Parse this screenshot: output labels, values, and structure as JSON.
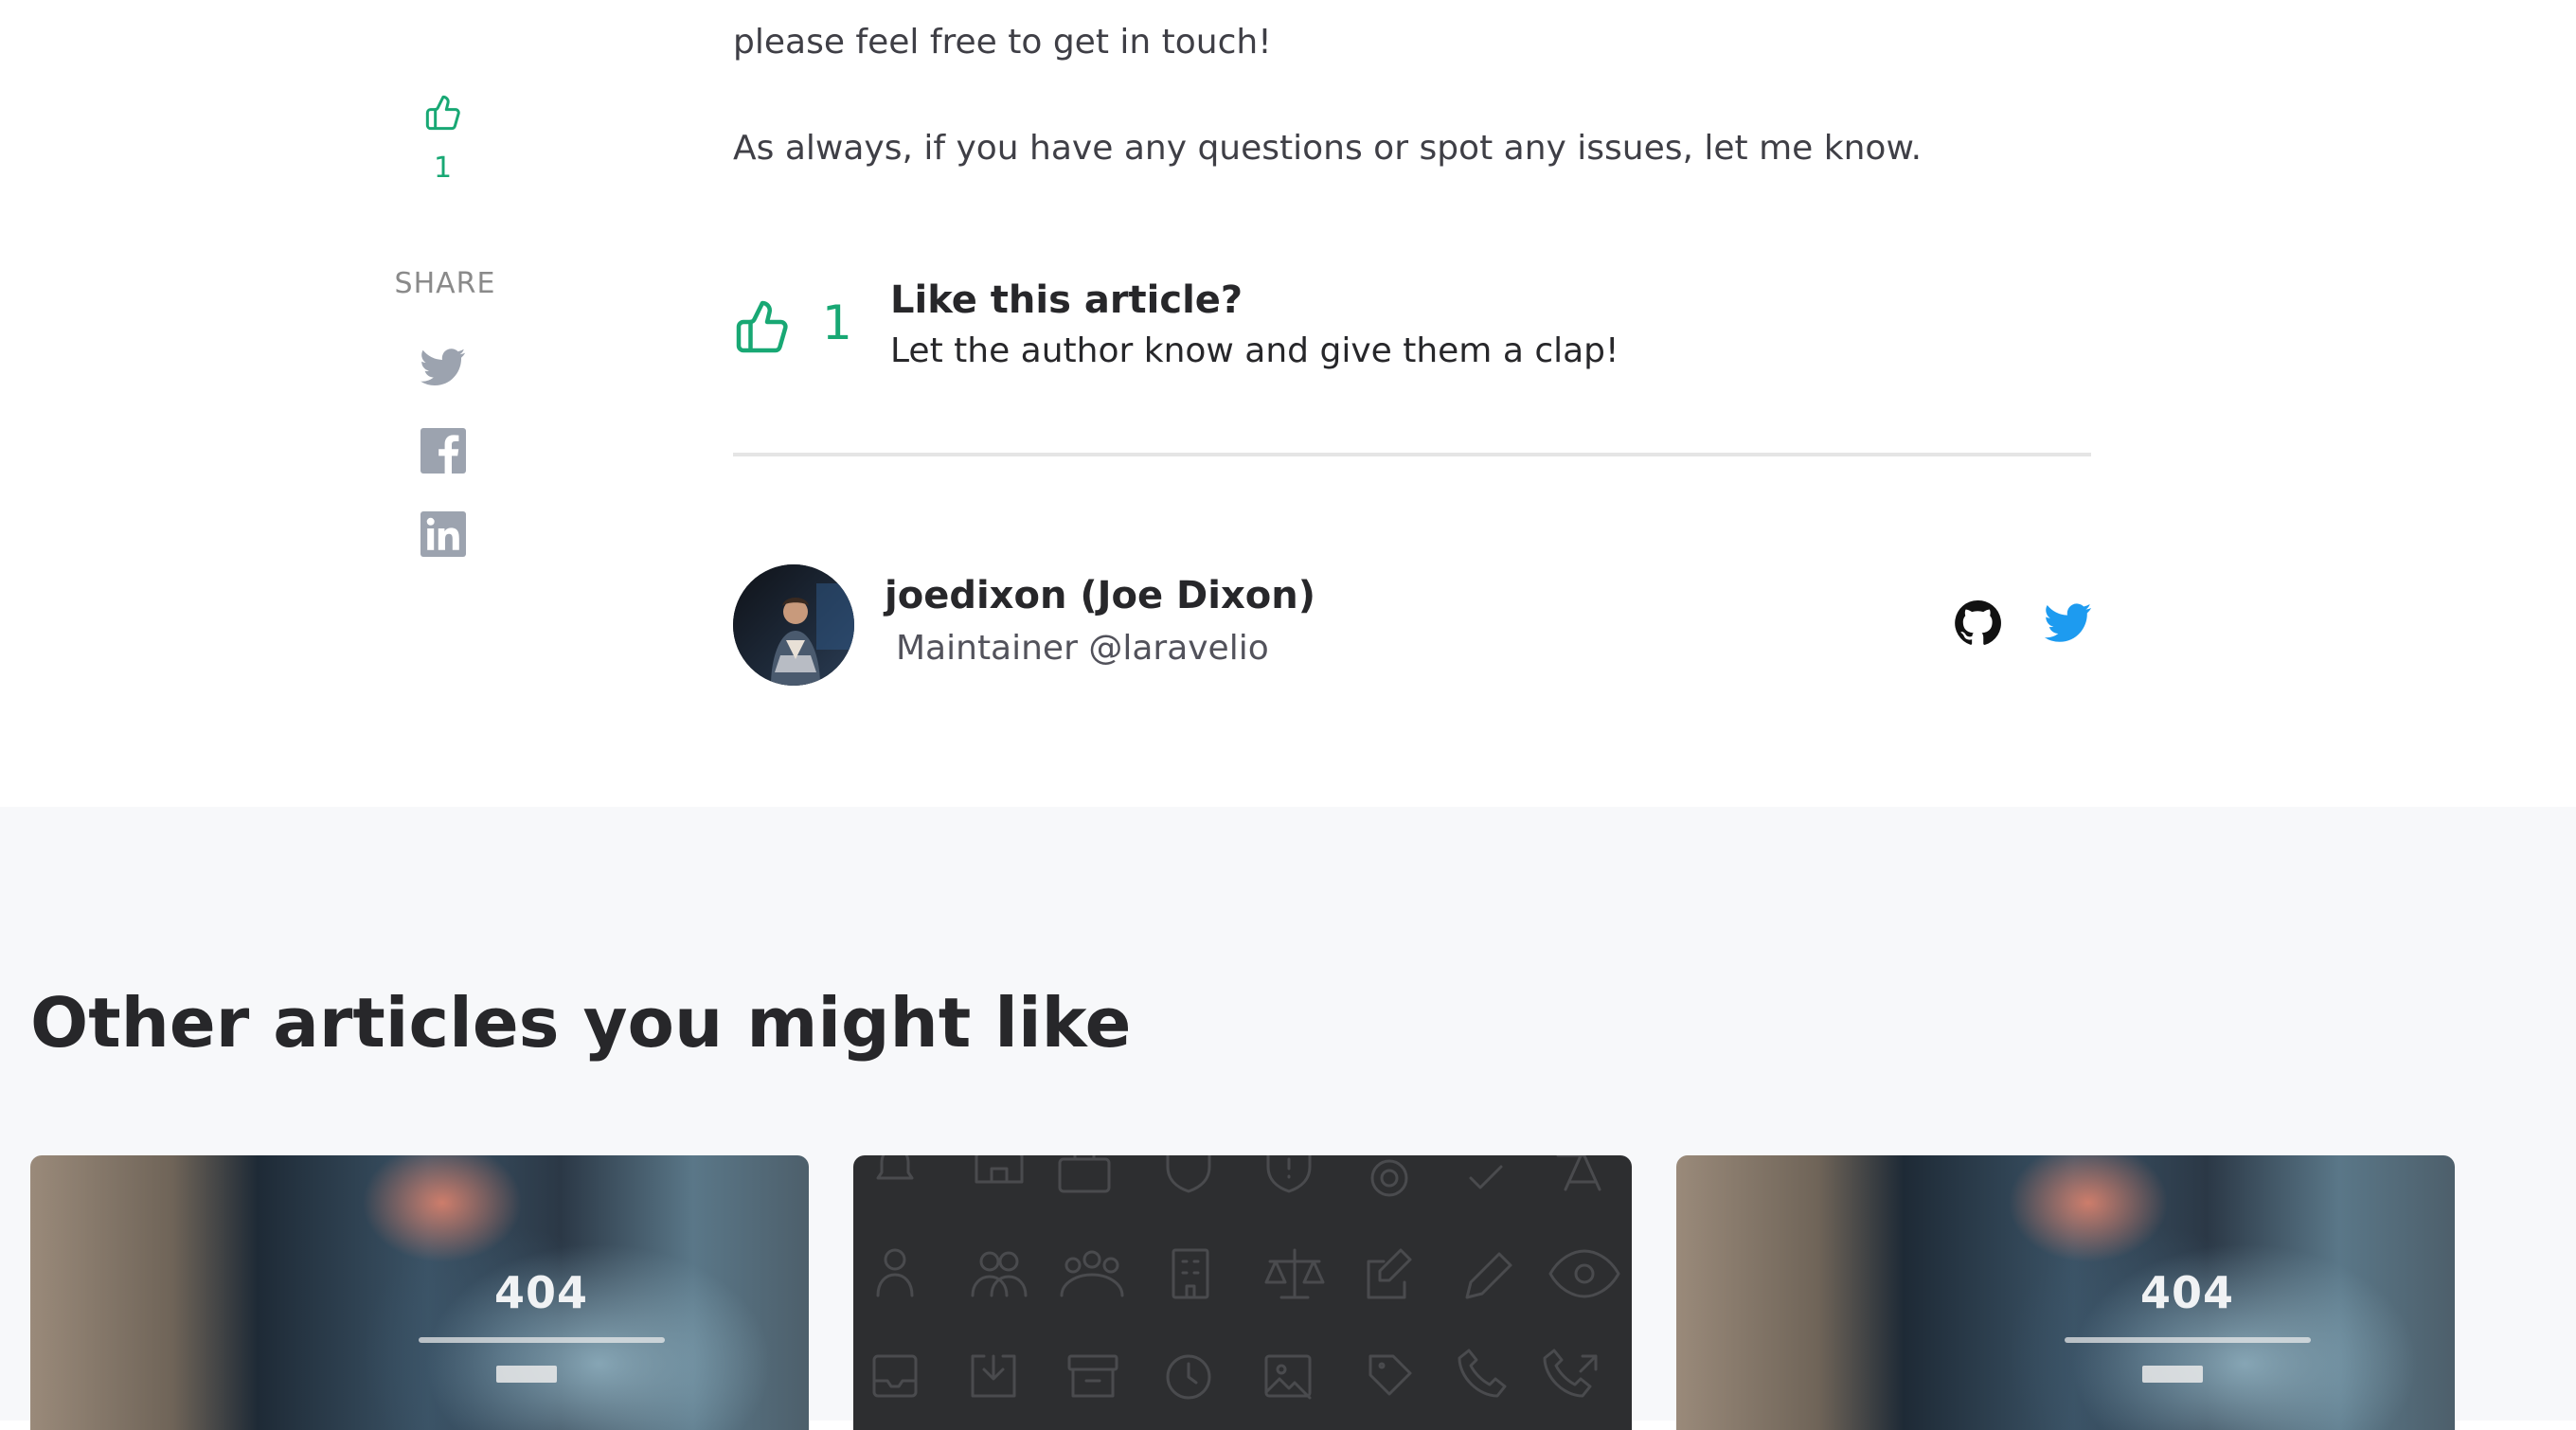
{
  "article": {
    "paragraph_partial": "please feel free to get in touch!",
    "paragraph_closing": "As always, if you have any questions or spot any issues, let me know."
  },
  "sidebar": {
    "clap_count": "1",
    "share_label": "SHARE",
    "share_icons": [
      "twitter-icon",
      "facebook-icon",
      "linkedin-icon"
    ]
  },
  "clap_banner": {
    "count": "1",
    "title": "Like this article?",
    "subtitle": "Let the author know and give them a clap!"
  },
  "author": {
    "name": "joedixon (Joe Dixon)",
    "bio": "Maintainer @laravelio",
    "links": [
      "github-icon",
      "twitter-icon"
    ]
  },
  "other_articles": {
    "heading": "Other articles you might like",
    "cards": [
      {
        "image": "404-page-photo",
        "image_text": "404"
      },
      {
        "image": "icon-pattern"
      },
      {
        "image": "404-page-photo",
        "image_text": "404"
      }
    ]
  },
  "colors": {
    "accent": "#18a874",
    "twitter": "#1d9bf0",
    "icon_gray": "#9ca3af",
    "section_bg": "#f7f8fa"
  }
}
